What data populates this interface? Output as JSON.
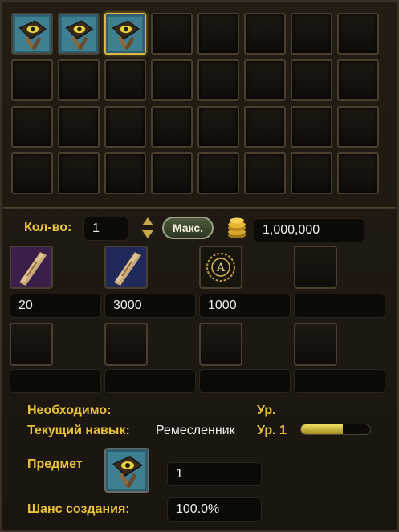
{
  "inventory": {
    "rows": 4,
    "cols": 8,
    "filled": [
      {
        "index": 0,
        "icon": "recipe-book-icon"
      },
      {
        "index": 1,
        "icon": "recipe-book-icon"
      },
      {
        "index": 2,
        "icon": "recipe-book-icon",
        "selected": true
      }
    ]
  },
  "quantity": {
    "label": "Кол-во:",
    "value": "1",
    "max_label": "Макс.",
    "cost_icon": "gold-coins-icon",
    "cost": "1,000,000"
  },
  "materials": [
    {
      "icon": "scroll-purple-icon",
      "count": "20"
    },
    {
      "icon": "scroll-blue-icon",
      "count": "3000"
    },
    {
      "icon": "rune-seal-icon",
      "count": "1000"
    },
    {
      "icon": "",
      "count": ""
    },
    {
      "icon": "",
      "count": ""
    },
    {
      "icon": "",
      "count": ""
    },
    {
      "icon": "",
      "count": ""
    },
    {
      "icon": "",
      "count": ""
    }
  ],
  "requirements": {
    "required_label": "Необходимо:",
    "level_label": "Ур.",
    "skill_label": "Текущий навык:",
    "skill_name": "Ремесленник",
    "skill_level": "Ур. 1",
    "skill_progress": 0.6,
    "item_label": "Предмет",
    "item_icon": "recipe-book-icon",
    "item_count": "1",
    "chance_label": "Шанс создания:",
    "chance_value": "100.0%"
  },
  "colors": {
    "accent_label": "#e8c23a",
    "selected_border": "#d8b84a"
  }
}
